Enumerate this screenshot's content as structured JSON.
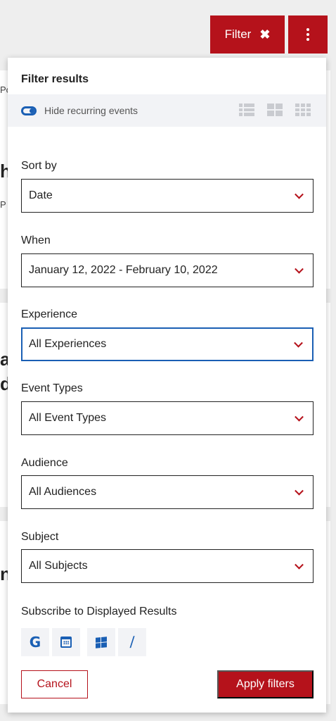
{
  "background": {
    "fragments": [
      {
        "text": "Po"
      },
      {
        "text": "h"
      },
      {
        "text": "P"
      },
      {
        "text": "a"
      },
      {
        "text": "d"
      },
      {
        "text": "n"
      }
    ]
  },
  "toolbar": {
    "filter_label": "Filter",
    "close_glyph": "✖"
  },
  "panel": {
    "title": "Filter results",
    "recurring_label": "Hide recurring events",
    "view_icons": [
      "list-view-icon",
      "grid-2-view-icon",
      "grid-3-view-icon"
    ]
  },
  "fields": {
    "sort_by": {
      "label": "Sort by",
      "value": "Date"
    },
    "when": {
      "label": "When",
      "value": "January 12, 2022 - February 10, 2022"
    },
    "experience": {
      "label": "Experience",
      "value": "All Experiences"
    },
    "event_types": {
      "label": "Event Types",
      "value": "All Event Types"
    },
    "audience": {
      "label": "Audience",
      "value": "All Audiences"
    },
    "subject": {
      "label": "Subject",
      "value": "All Subjects"
    }
  },
  "subscribe": {
    "label": "Subscribe to Displayed Results",
    "google_glyph": "G",
    "rss_glyph": "⧸",
    "icons": [
      "google-calendar-icon",
      "calendar-icon",
      "windows-icon",
      "rss-icon"
    ]
  },
  "actions": {
    "cancel": "Cancel",
    "apply": "Apply filters"
  },
  "colors": {
    "accent": "#b5121b",
    "link": "#1a5fb4",
    "muted_bg": "#f2f3f6"
  }
}
